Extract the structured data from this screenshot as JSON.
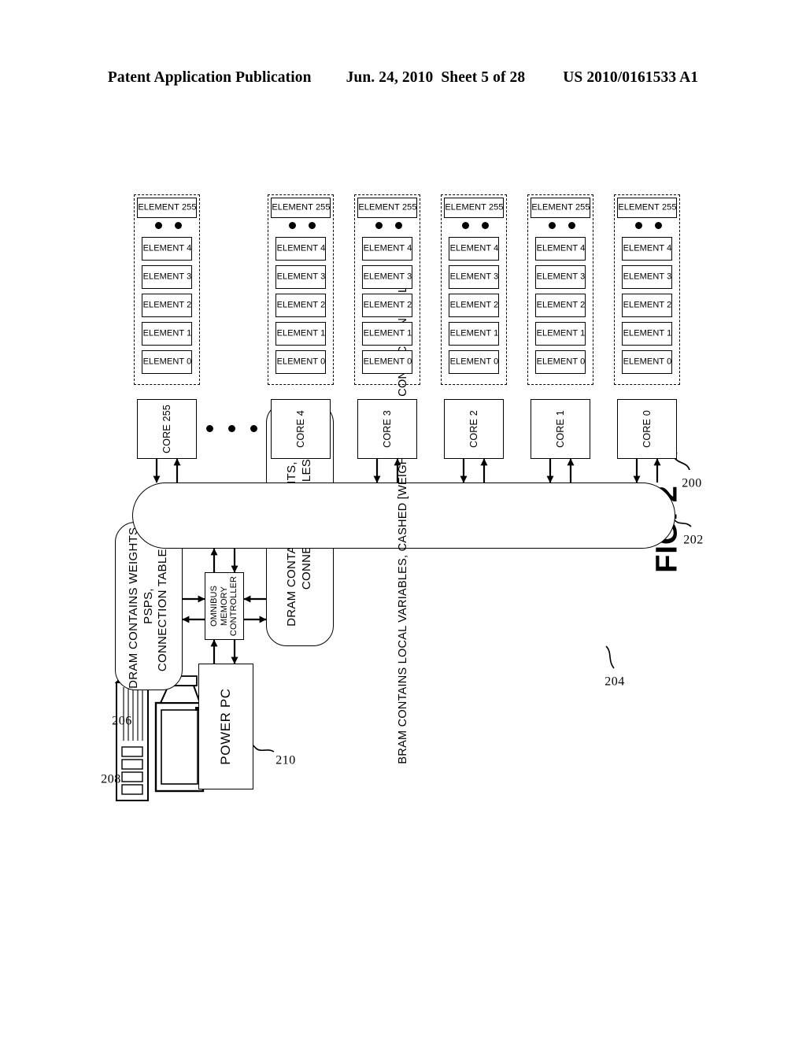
{
  "header": {
    "publication": "Patent Application Publication",
    "date": "Jun. 24, 2010",
    "sheet": "Sheet 5 of 28",
    "patent_number": "US 2010/0161533 A1"
  },
  "figure": {
    "caption": "FIG. 2",
    "workstation": {
      "ref_tower": "208",
      "ref_monitor": "206",
      "icon": "workstation-icon"
    },
    "power_pc": {
      "label": "POWER PC",
      "ref": "210"
    },
    "memory_controller": {
      "label": "OMNIBUS\nMEMORY\nCONTROLLER"
    },
    "dram_top": {
      "label": "DRAM CONTAINS WEIGHTS, PSPS,\nCONNECTION TABLES"
    },
    "dram_bottom": {
      "label": "DRAM CONTAINS WEIGHTS, PSPS,\nCONNECTION TABLES",
      "ref": "204"
    },
    "bram_bus": {
      "label": "BRAM CONTAINS LOCAL VARIABLES, CASHED [WEIGHTS, PSPS, CONNECTION TABLES]",
      "ref": "202"
    },
    "core_ref": "200",
    "cores": [
      {
        "label": "CORE 0",
        "elements": [
          "ELEMENT 0",
          "ELEMENT 1",
          "ELEMENT 2",
          "ELEMENT 3",
          "ELEMENT 4"
        ],
        "last_element": "ELEMENT 255"
      },
      {
        "label": "CORE 1",
        "elements": [
          "ELEMENT 0",
          "ELEMENT 1",
          "ELEMENT 2",
          "ELEMENT 3",
          "ELEMENT 4"
        ],
        "last_element": "ELEMENT 255"
      },
      {
        "label": "CORE 2",
        "elements": [
          "ELEMENT 0",
          "ELEMENT 1",
          "ELEMENT 2",
          "ELEMENT 3",
          "ELEMENT 4"
        ],
        "last_element": "ELEMENT 255"
      },
      {
        "label": "CORE 3",
        "elements": [
          "ELEMENT 0",
          "ELEMENT 1",
          "ELEMENT 2",
          "ELEMENT 3",
          "ELEMENT 4"
        ],
        "last_element": "ELEMENT 255"
      },
      {
        "label": "CORE 4",
        "elements": [
          "ELEMENT 0",
          "ELEMENT 1",
          "ELEMENT 2",
          "ELEMENT 3",
          "ELEMENT 4"
        ],
        "last_element": "ELEMENT 255"
      },
      {
        "label": "CORE 255",
        "elements": [
          "ELEMENT 0",
          "ELEMENT 1",
          "ELEMENT 2",
          "ELEMENT 3",
          "ELEMENT 4"
        ],
        "last_element": "ELEMENT 255"
      }
    ],
    "ellipsis_vertical": "• • •",
    "ellipsis_horizontal": "• •"
  },
  "colors": {
    "ink": "#000000",
    "paper": "#ffffff"
  }
}
